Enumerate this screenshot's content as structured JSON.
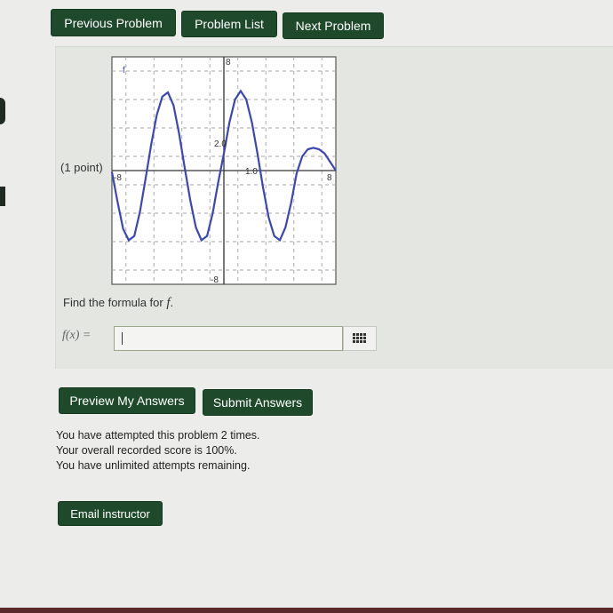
{
  "nav": {
    "previous": "Previous Problem",
    "list": "Problem List",
    "next": "Next Problem"
  },
  "problem": {
    "points": "(1 point)",
    "instruction": "Find the formula for",
    "function_name": "f",
    "input_label": "f(x) =",
    "input_value": ""
  },
  "graph": {
    "curve_label": "f",
    "x_axis_max_label": "8",
    "x_axis_min_label": "-8",
    "y_axis_max_label": "8",
    "y_axis_min_label": "-8",
    "y_tick_label": "2.0",
    "x_tick_label": "1.0",
    "curve_color": "#3b47b8"
  },
  "chart_data": {
    "type": "line",
    "title": "",
    "xlabel": "",
    "ylabel": "",
    "xlim": [
      -8,
      8
    ],
    "ylim": [
      -8,
      8
    ],
    "grid": true,
    "series": [
      {
        "x": [
          -8,
          -7.6,
          -7.2,
          -6.8,
          -6.4,
          -6.0,
          -5.6,
          -5.2,
          -4.8,
          -4.4,
          -4.0,
          -3.6,
          -3.2,
          -2.8,
          -2.4,
          -2.0,
          -1.6,
          -1.2,
          -0.8,
          -0.4,
          0.0,
          0.4,
          0.8,
          1.2,
          1.6,
          2.0,
          2.4,
          2.8,
          3.2,
          3.6,
          4.0,
          4.4,
          4.8,
          5.2,
          5.6,
          6.0,
          6.4,
          6.8,
          7.2,
          7.6,
          8.0
        ],
        "values": [
          -0.1,
          -2.2,
          -4.1,
          -4.9,
          -4.6,
          -2.9,
          -0.6,
          1.8,
          3.9,
          5.2,
          5.5,
          4.6,
          2.6,
          0.2,
          -2.1,
          -4.0,
          -4.9,
          -4.6,
          -3.0,
          -0.8,
          1.2,
          3.4,
          5.0,
          5.6,
          5.0,
          3.4,
          1.2,
          -1.2,
          -3.3,
          -4.6,
          -4.9,
          -4.0,
          -2.3,
          -0.2,
          1.0,
          1.5,
          1.6,
          1.5,
          1.2,
          0.6,
          0.0
        ]
      }
    ]
  },
  "actions": {
    "preview": "Preview My Answers",
    "submit": "Submit Answers",
    "email": "Email instructor"
  },
  "status": {
    "attempts": "You have attempted this problem 2 times.",
    "score": "Your overall recorded score is 100%.",
    "remaining": "You have unlimited attempts remaining."
  }
}
